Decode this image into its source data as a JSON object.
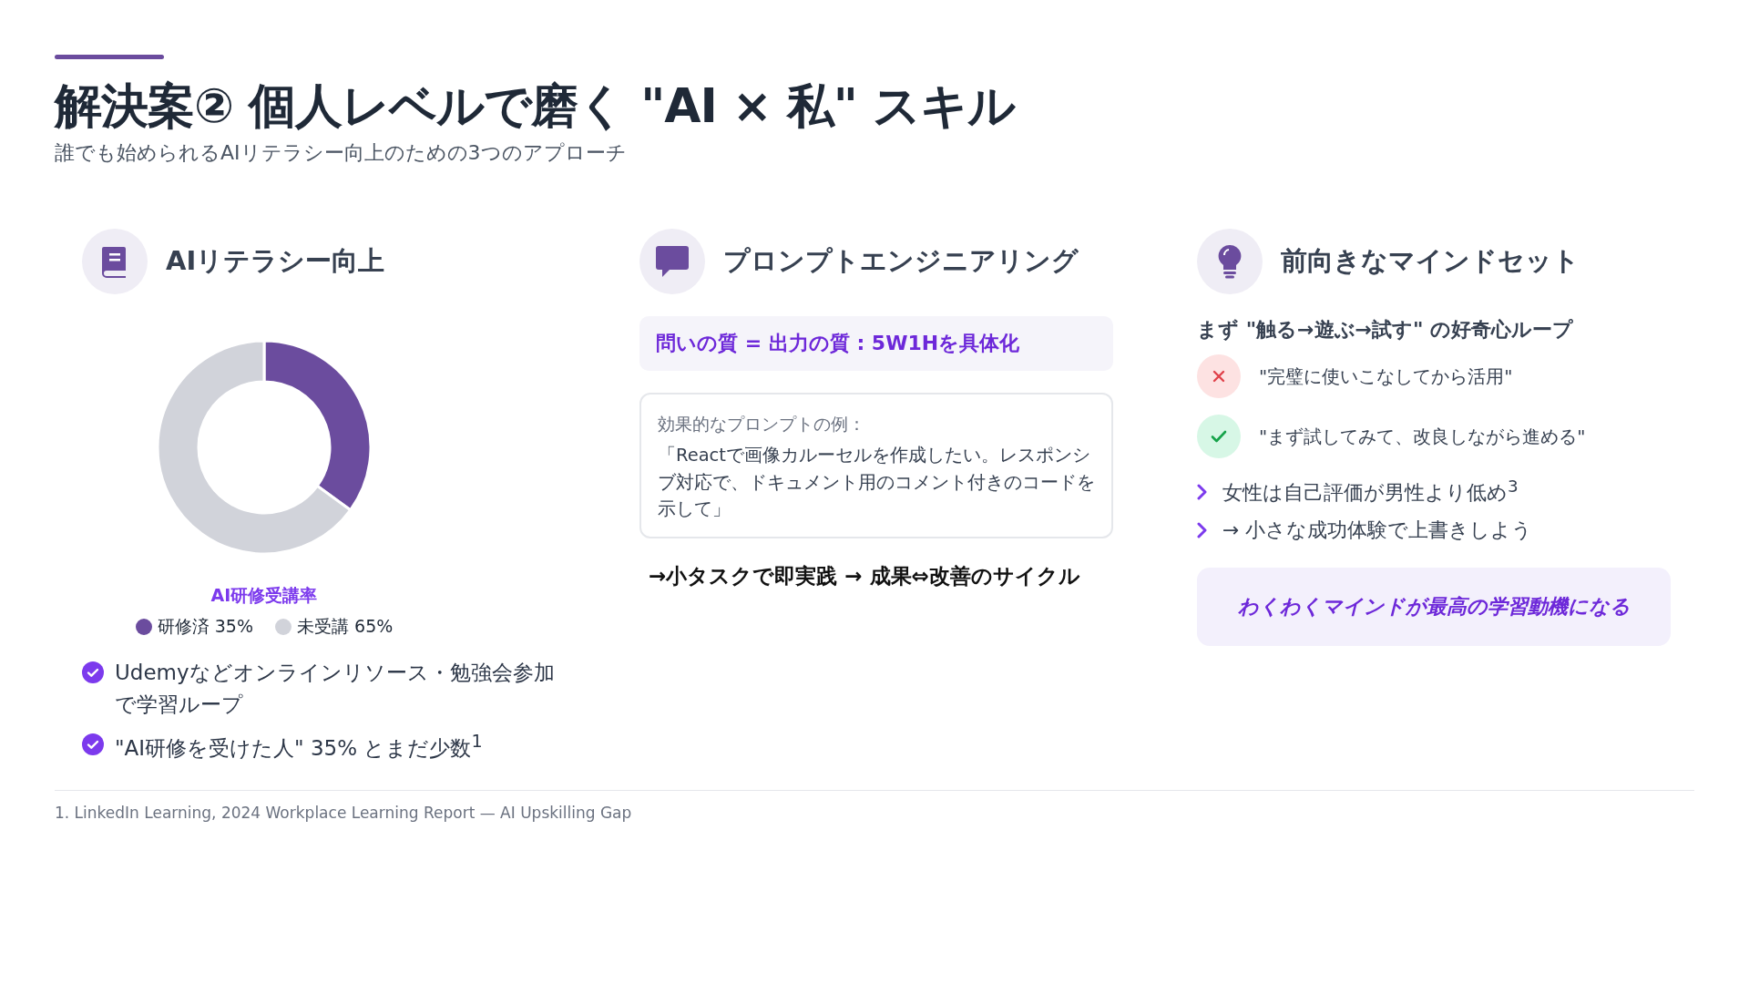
{
  "header": {
    "title": "解決案② 個人レベルで磨く \"AI × 私\" スキル",
    "subtitle": "誰でも始められるAIリテラシー向上のための3つのアプローチ"
  },
  "columns": [
    {
      "kind": "literacy",
      "heading": "AIリテラシー向上",
      "chart_data": {
        "type": "donut",
        "title": "AI研修受講率",
        "categories": [
          "研修済 35%",
          "未受講 65%"
        ],
        "values": [
          35,
          65
        ],
        "colors": [
          "#6b4c9e",
          "#d1d3da"
        ],
        "legend": "bottom"
      },
      "checklist": [
        "Udemyなどオンラインリソース・勉強会参加で学習ループ",
        "\"AI研修を受けた人\" 35% とまだ少数$^{1}$"
      ]
    },
    {
      "kind": "prompt",
      "heading": "プロンプトエンジニアリング",
      "highlight": "問いの質 = 出力の質 : 5W1Hを具体化",
      "example": {
        "label": "効果的なプロンプトの例：",
        "text": "「Reactで画像カルーセルを作成したい。レスポンシブ対応で、ドキュメント用のコメント付きのコードを示して」"
      },
      "cycle": "→小タスクで即実践 → 成果⇔改善のサイクル"
    },
    {
      "kind": "mindset",
      "heading": "前向きなマインドセット",
      "subheading": "まず \"触る→遊ぶ→試す\" の好奇心ループ",
      "contrasts": [
        {
          "kind": "bad",
          "text": "\"完璧に使いこなしてから活用\""
        },
        {
          "kind": "good",
          "text": "\"まず試してみて、改良しながら進める\""
        }
      ],
      "points": [
        "女性は自己評価が男性より低め$^{3}$",
        "→ 小さな成功体験で上書きしよう"
      ],
      "quote": "わくわくマインドが最高の学習動機になる"
    }
  ],
  "footnote": "1. LinkedIn Learning, 2024 Workplace Learning Report — AI Upskilling Gap"
}
